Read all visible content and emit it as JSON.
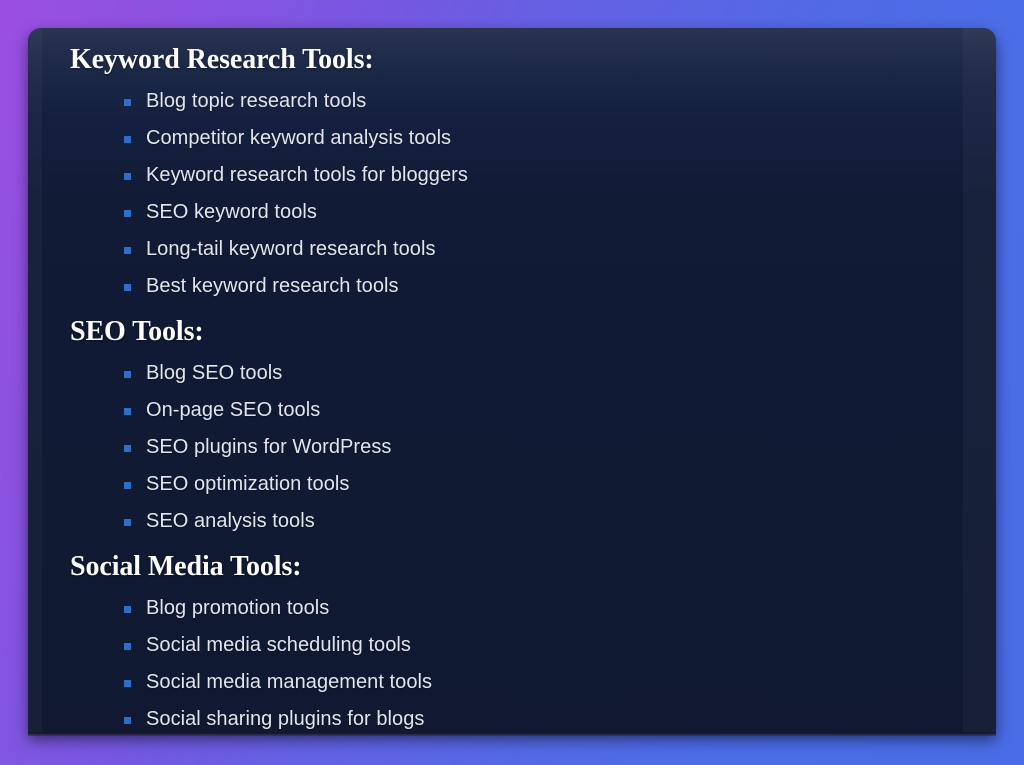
{
  "theme": {
    "background_gradient_from": "#9B4FE2",
    "background_gradient_to": "#4A6CE6",
    "card_background": "#101B35",
    "heading_color": "#FDFDFE",
    "body_text_color": "#E3E5EC",
    "bullet_color": "#2C6FC8"
  },
  "card": {
    "sections": [
      {
        "heading": "Keyword Research Tools:",
        "items": [
          "Blog topic research tools",
          "Competitor keyword analysis tools",
          "Keyword research tools for bloggers",
          "SEO keyword tools",
          "Long-tail keyword research tools",
          "Best keyword research tools"
        ]
      },
      {
        "heading": "SEO Tools:",
        "items": [
          "Blog SEO tools",
          "On-page SEO tools",
          "SEO plugins for WordPress",
          "SEO optimization tools",
          "SEO analysis tools"
        ]
      },
      {
        "heading": "Social Media Tools:",
        "items": [
          "Blog promotion tools",
          "Social media scheduling tools",
          "Social media management tools",
          "Social sharing plugins for blogs"
        ]
      }
    ]
  }
}
